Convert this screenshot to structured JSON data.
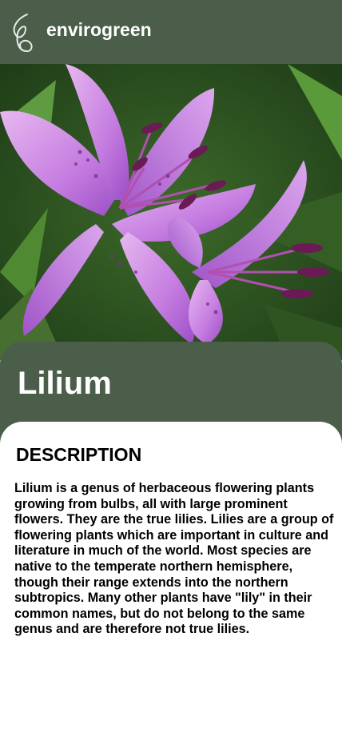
{
  "header": {
    "app_name": "envirogreen",
    "logo_icon": "leaf-logo-icon"
  },
  "hero": {
    "image": "lily-flower-photo",
    "colors": {
      "petal": "#c57ce0",
      "petal_dark": "#8d3fb1",
      "leaf": "#3f6b2a"
    }
  },
  "plant": {
    "name": "Lilium"
  },
  "content": {
    "heading": "DESCRIPTION",
    "description": "Lilium is a genus of herbaceous flowering plants growing from bulbs, all with large prominent flowers. They are the true lilies. Lilies are a group of flowering plants which are important in culture and literature in much of the world. Most species are native to the temperate northern hemisphere, though their range extends into the northern subtropics. Many other plants have \"lily\" in their common names, but do not belong to the same genus and are therefore not true lilies."
  },
  "colors": {
    "brand": "#4a5e4a",
    "text": "#000000",
    "background": "#ffffff"
  }
}
